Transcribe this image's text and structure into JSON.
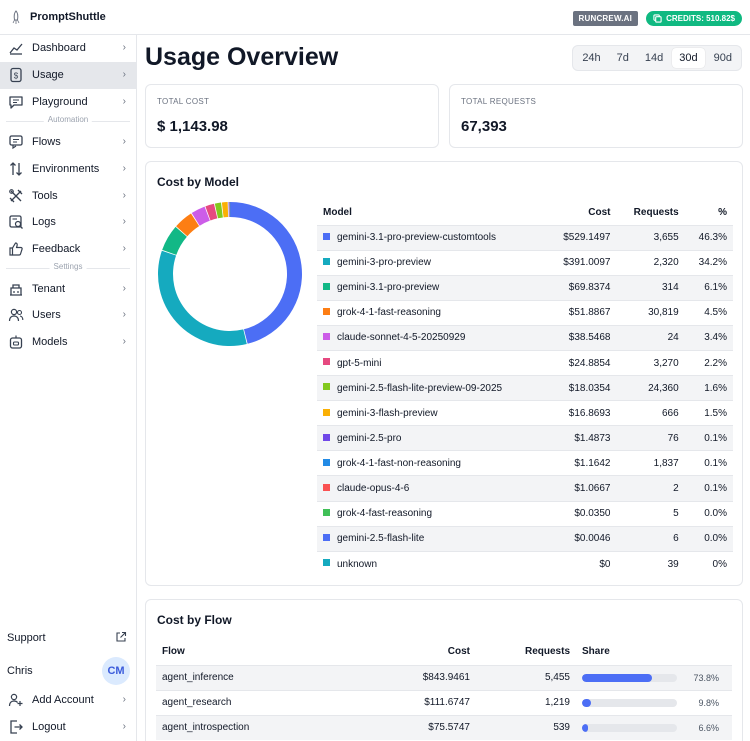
{
  "app": {
    "title": "PromptShuttle",
    "org_badge": "RUNCREW.AI",
    "credits_badge": "CREDITS: 510.82$"
  },
  "sidebar": {
    "items": [
      {
        "label": "Dashboard",
        "icon": "chart-line-icon"
      },
      {
        "label": "Usage",
        "icon": "receipt-dollar-icon",
        "active": true
      },
      {
        "label": "Playground",
        "icon": "chat-icon"
      }
    ],
    "section_automation": "Automation",
    "automation_items": [
      {
        "label": "Flows",
        "icon": "flow-icon"
      },
      {
        "label": "Environments",
        "icon": "arrows-updown-icon"
      },
      {
        "label": "Tools",
        "icon": "tools-icon"
      },
      {
        "label": "Logs",
        "icon": "logs-search-icon"
      },
      {
        "label": "Feedback",
        "icon": "thumbs-up-icon"
      }
    ],
    "section_settings": "Settings",
    "settings_items": [
      {
        "label": "Tenant",
        "icon": "building-icon"
      },
      {
        "label": "Users",
        "icon": "users-icon"
      },
      {
        "label": "Models",
        "icon": "robot-icon"
      }
    ],
    "support_label": "Support",
    "user_name": "Chris",
    "user_initials": "CM",
    "add_account_label": "Add Account",
    "logout_label": "Logout"
  },
  "main": {
    "title": "Usage Overview",
    "ranges": [
      "24h",
      "7d",
      "14d",
      "30d",
      "90d"
    ],
    "selected_range": "30d",
    "total_cost_label": "TOTAL COST",
    "total_cost_value": "$ 1,143.98",
    "total_requests_label": "TOTAL REQUESTS",
    "total_requests_value": "67,393"
  },
  "cost_by_model": {
    "title": "Cost by Model",
    "columns": [
      "Model",
      "Cost",
      "Requests",
      "%"
    ],
    "rows": [
      {
        "model": "gemini-3.1-pro-preview-customtools",
        "cost": "$529.1497",
        "requests": "3,655",
        "pct": "46.3%",
        "value": 529.1497,
        "color": "#4c6ef5"
      },
      {
        "model": "gemini-3-pro-preview",
        "cost": "$391.0097",
        "requests": "2,320",
        "pct": "34.2%",
        "value": 391.0097,
        "color": "#15aabf"
      },
      {
        "model": "gemini-3.1-pro-preview",
        "cost": "$69.8374",
        "requests": "314",
        "pct": "6.1%",
        "value": 69.8374,
        "color": "#12b886"
      },
      {
        "model": "grok-4-1-fast-reasoning",
        "cost": "$51.8867",
        "requests": "30,819",
        "pct": "4.5%",
        "value": 51.8867,
        "color": "#fd7e14"
      },
      {
        "model": "claude-sonnet-4-5-20250929",
        "cost": "$38.5468",
        "requests": "24",
        "pct": "3.4%",
        "value": 38.5468,
        "color": "#cc5de8"
      },
      {
        "model": "gpt-5-mini",
        "cost": "$24.8854",
        "requests": "3,270",
        "pct": "2.2%",
        "value": 24.8854,
        "color": "#e64980"
      },
      {
        "model": "gemini-2.5-flash-lite-preview-09-2025",
        "cost": "$18.0354",
        "requests": "24,360",
        "pct": "1.6%",
        "value": 18.0354,
        "color": "#82c91e"
      },
      {
        "model": "gemini-3-flash-preview",
        "cost": "$16.8693",
        "requests": "666",
        "pct": "1.5%",
        "value": 16.8693,
        "color": "#fab005"
      },
      {
        "model": "gemini-2.5-pro",
        "cost": "$1.4873",
        "requests": "76",
        "pct": "0.1%",
        "value": 1.4873,
        "color": "#7048e8"
      },
      {
        "model": "grok-4-1-fast-non-reasoning",
        "cost": "$1.1642",
        "requests": "1,837",
        "pct": "0.1%",
        "value": 1.1642,
        "color": "#228be6"
      },
      {
        "model": "claude-opus-4-6",
        "cost": "$1.0667",
        "requests": "2",
        "pct": "0.1%",
        "value": 1.0667,
        "color": "#fa5252"
      },
      {
        "model": "grok-4-fast-reasoning",
        "cost": "$0.0350",
        "requests": "5",
        "pct": "0.0%",
        "value": 0.035,
        "color": "#40c057"
      },
      {
        "model": "gemini-2.5-flash-lite",
        "cost": "$0.0046",
        "requests": "6",
        "pct": "0.0%",
        "value": 0.0046,
        "color": "#4c6ef5"
      },
      {
        "model": "unknown",
        "cost": "$0",
        "requests": "39",
        "pct": "0%",
        "value": 0,
        "color": "#15aabf"
      }
    ]
  },
  "cost_by_flow": {
    "title": "Cost by Flow",
    "columns": [
      "Flow",
      "Cost",
      "Requests",
      "Share"
    ],
    "rows": [
      {
        "flow": "agent_inference",
        "cost": "$843.9461",
        "requests": "5,455",
        "share": 73.8,
        "share_label": "73.8%"
      },
      {
        "flow": "agent_research",
        "cost": "$111.6747",
        "requests": "1,219",
        "share": 9.8,
        "share_label": "9.8%"
      },
      {
        "flow": "agent_introspection",
        "cost": "$75.5747",
        "requests": "539",
        "share": 6.6,
        "share_label": "6.6%"
      }
    ]
  },
  "chart_data": {
    "type": "pie",
    "title": "Cost by Model",
    "categories": [
      "gemini-3.1-pro-preview-customtools",
      "gemini-3-pro-preview",
      "gemini-3.1-pro-preview",
      "grok-4-1-fast-reasoning",
      "claude-sonnet-4-5-20250929",
      "gpt-5-mini",
      "gemini-2.5-flash-lite-preview-09-2025",
      "gemini-3-flash-preview",
      "gemini-2.5-pro",
      "grok-4-1-fast-non-reasoning",
      "claude-opus-4-6",
      "grok-4-fast-reasoning",
      "gemini-2.5-flash-lite",
      "unknown"
    ],
    "values": [
      529.1497,
      391.0097,
      69.8374,
      51.8867,
      38.5468,
      24.8854,
      18.0354,
      16.8693,
      1.4873,
      1.1642,
      1.0667,
      0.035,
      0.0046,
      0
    ],
    "colors": [
      "#4c6ef5",
      "#15aabf",
      "#12b886",
      "#fd7e14",
      "#cc5de8",
      "#e64980",
      "#82c91e",
      "#fab005",
      "#7048e8",
      "#228be6",
      "#fa5252",
      "#40c057",
      "#4c6ef5",
      "#15aabf"
    ],
    "donut": true
  }
}
